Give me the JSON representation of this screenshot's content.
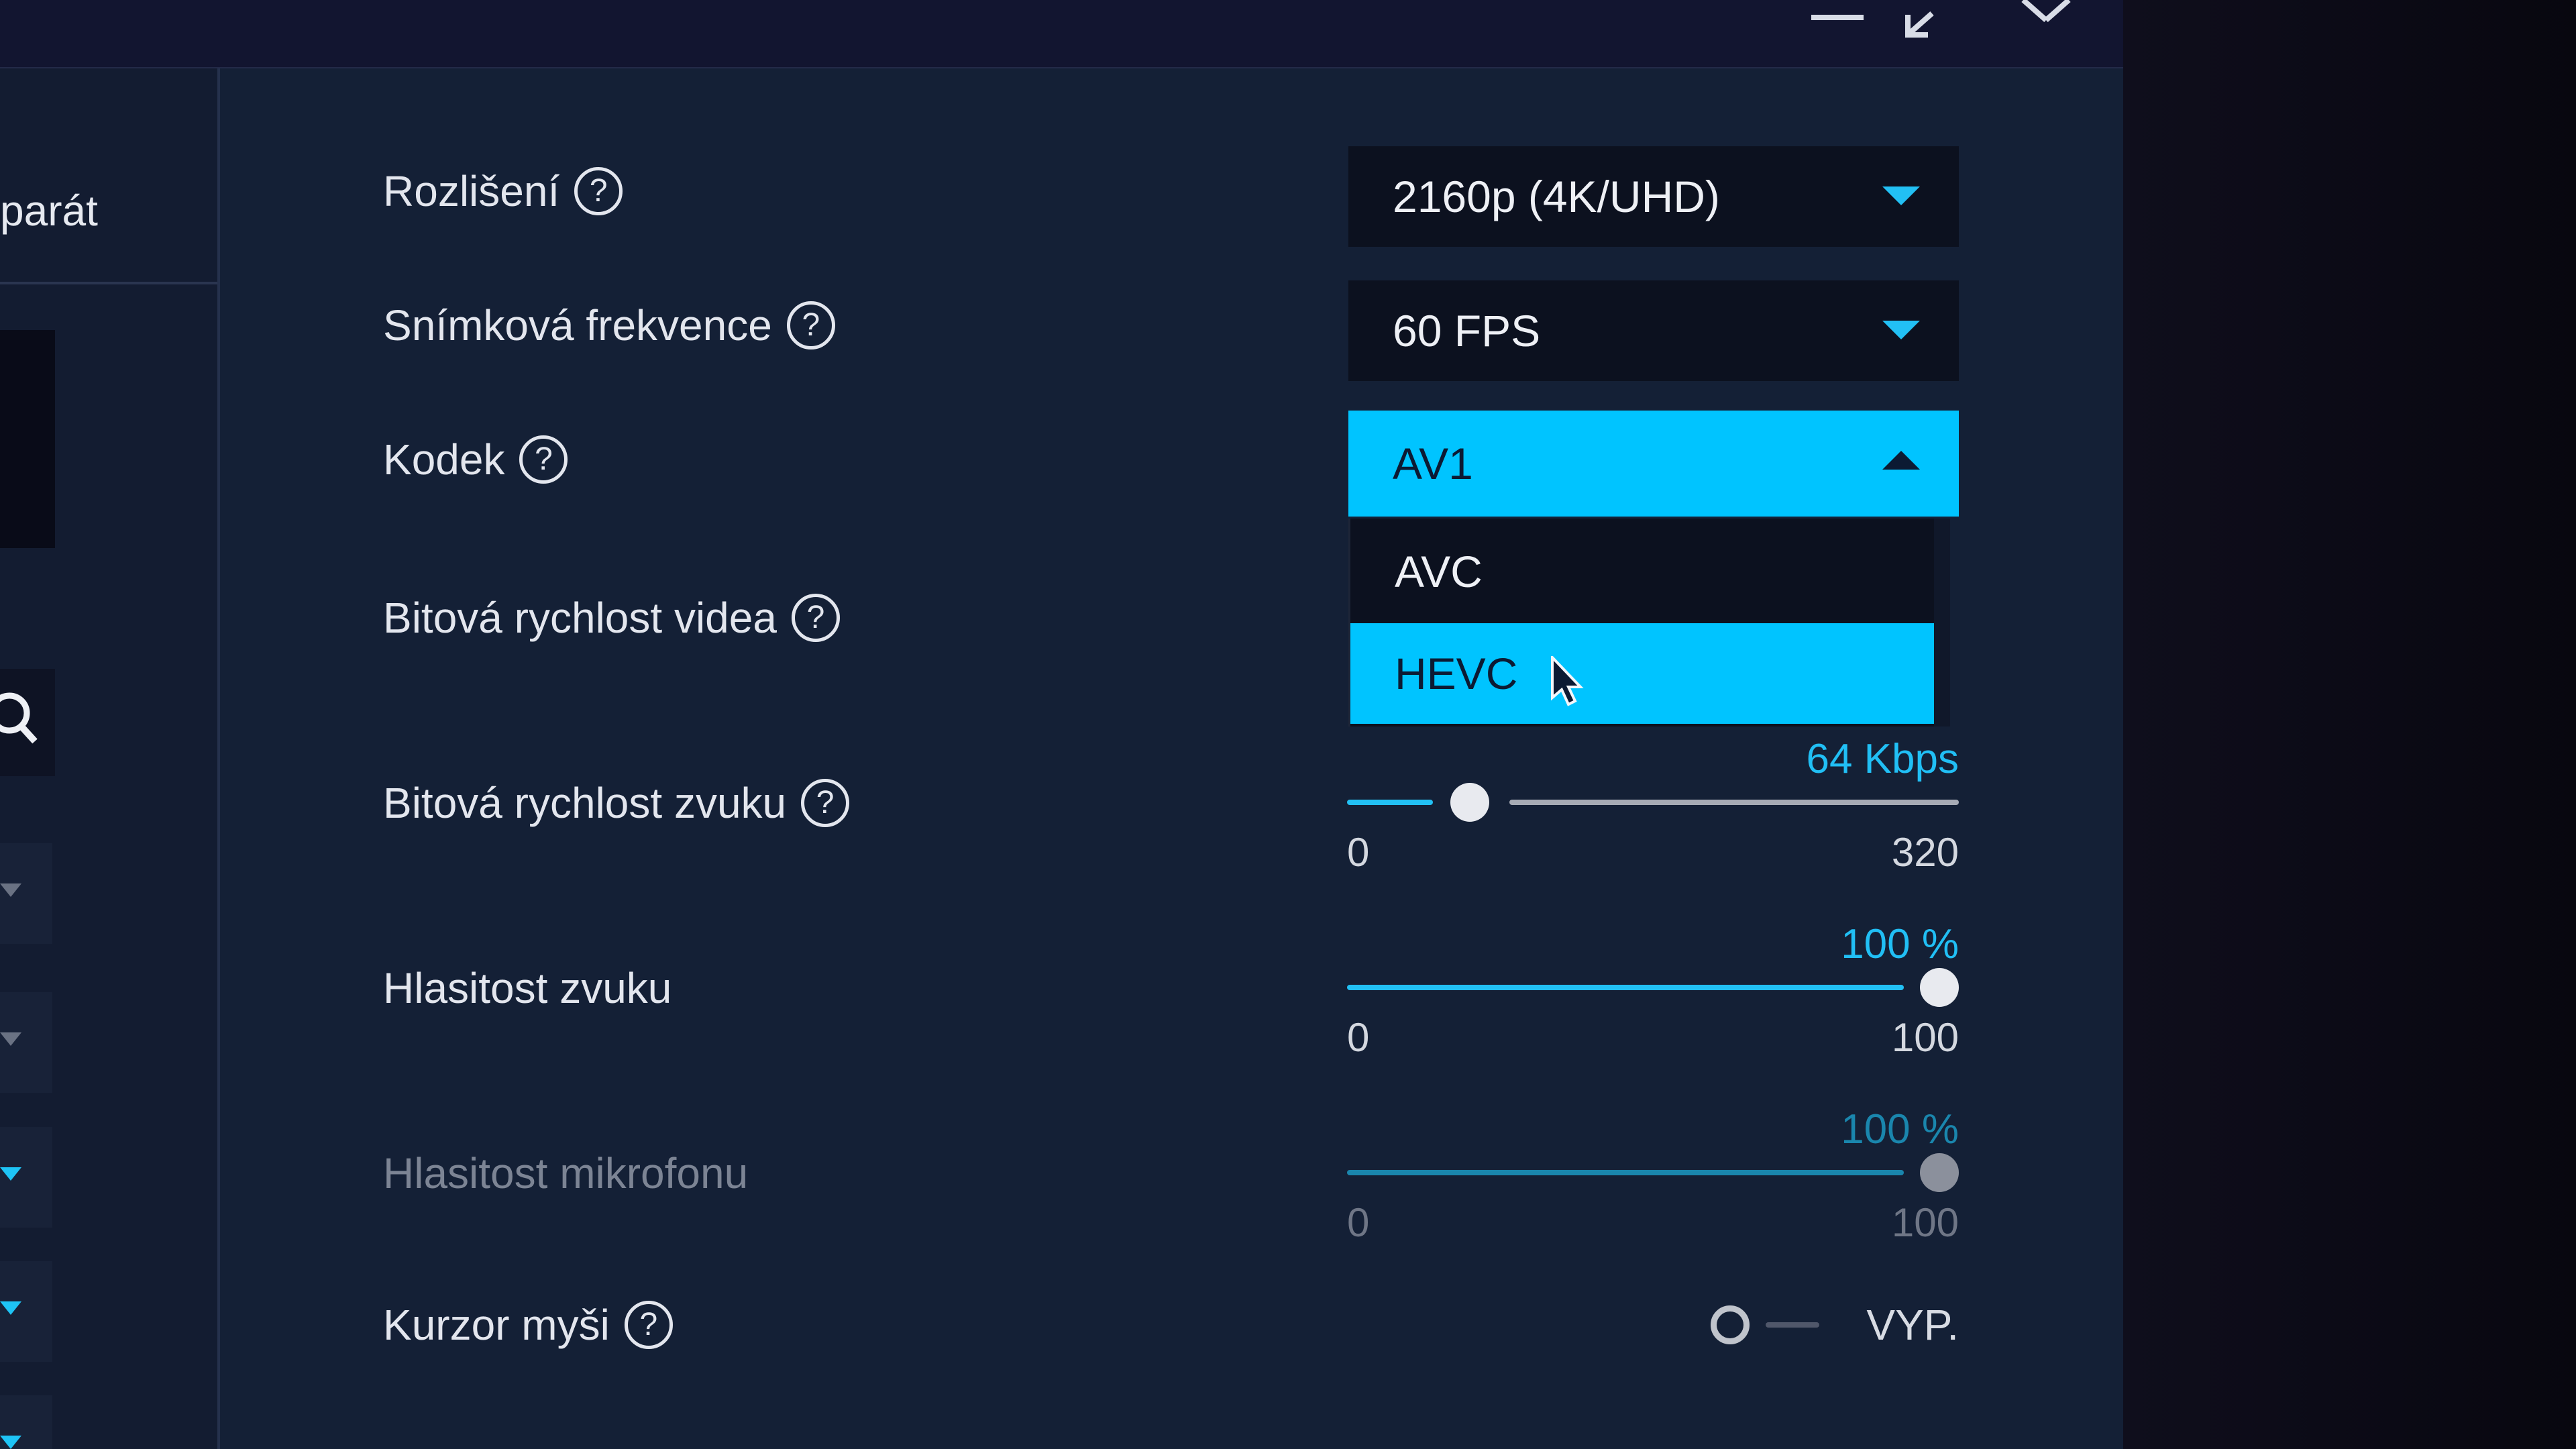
{
  "window": {
    "controls": {
      "minimize": "minimize-icon",
      "restore": "restore-icon",
      "close": "close-icon"
    }
  },
  "sidebar": {
    "label": "parát",
    "icons": {
      "search": "search-icon"
    }
  },
  "settings": {
    "resolution": {
      "label": "Rozlišení",
      "value": "2160p (4K/UHD)"
    },
    "framerate": {
      "label": "Snímková frekvence",
      "value": "60 FPS"
    },
    "codec": {
      "label": "Kodek",
      "value": "AV1",
      "options": [
        "AVC",
        "HEVC"
      ],
      "hovered": "HEVC"
    },
    "video_bitrate": {
      "label": "Bitová rychlost videa"
    },
    "audio_bitrate": {
      "label": "Bitová rychlost zvuku",
      "value_text": "64 Kbps",
      "min": "0",
      "max": "320",
      "value": 64
    },
    "audio_volume": {
      "label": "Hlasitost zvuku",
      "value_text": "100 %",
      "min": "0",
      "max": "100",
      "value": 100
    },
    "mic_volume": {
      "label": "Hlasitost mikrofonu",
      "value_text": "100 %",
      "min": "0",
      "max": "100",
      "value": 100
    },
    "mouse_cursor": {
      "label": "Kurzor myši",
      "state": "VYP."
    }
  },
  "help_glyph": "?",
  "colors": {
    "accent": "#00c4ff",
    "panel": "#142036",
    "titlebar": "#121530"
  }
}
